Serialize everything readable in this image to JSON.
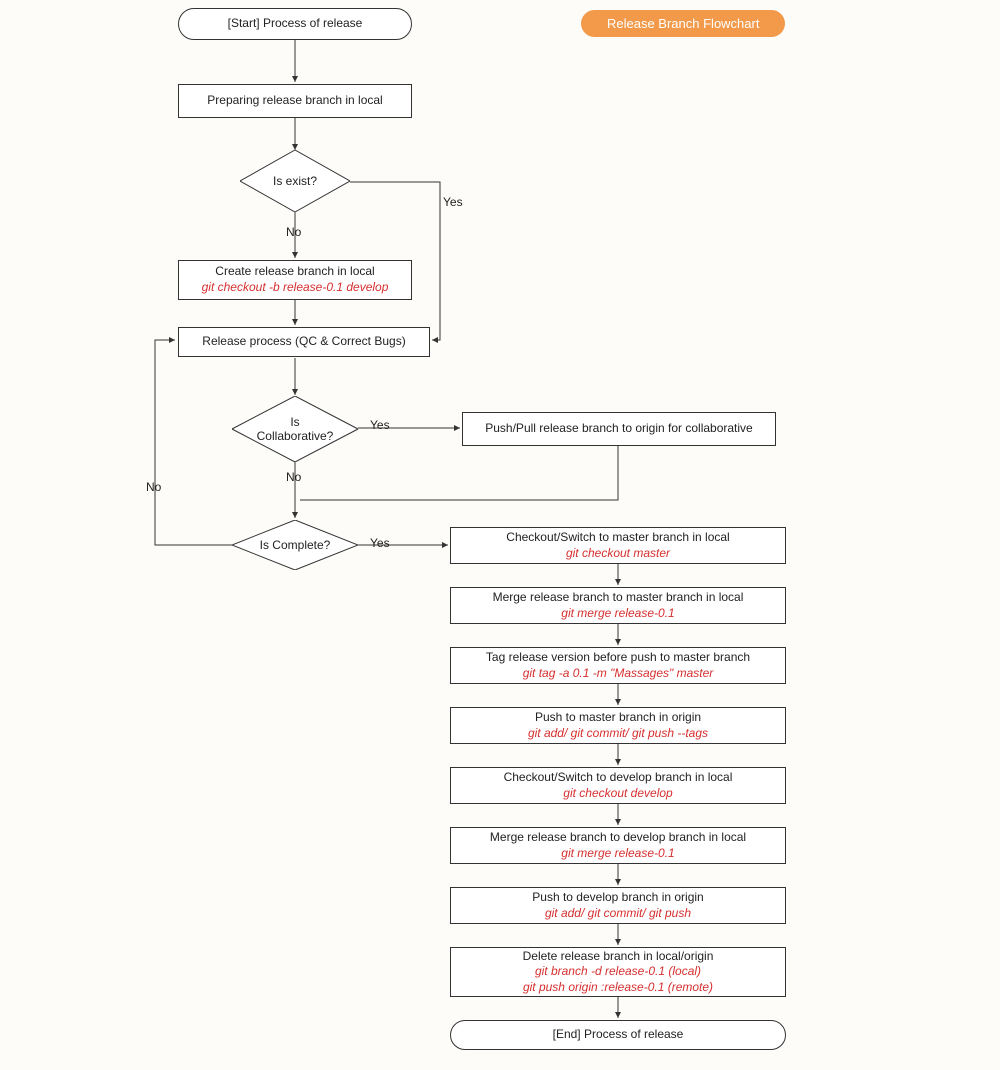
{
  "title_badge": "Release Branch Flowchart",
  "nodes": {
    "start": "[Start] Process of release",
    "prepare": "Preparing release branch in local",
    "exist_q": "Is exist?",
    "create": {
      "text": "Create release branch in local",
      "cmd": "git checkout -b release-0.1 develop"
    },
    "qc": "Release process (QC & Correct Bugs)",
    "collab_q": "Is\nCollaborative?",
    "pushpull": "Push/Pull release branch to origin for collaborative",
    "complete_q": "Is Complete?",
    "checkout_master": {
      "text": "Checkout/Switch to master branch in local",
      "cmd": "git checkout master"
    },
    "merge_master": {
      "text": "Merge release branch to master branch in local",
      "cmd": "git merge release-0.1"
    },
    "tag": {
      "text": "Tag release version before push to master branch",
      "cmd": "git tag -a 0.1 -m \"Massages\" master"
    },
    "push_master": {
      "text": "Push to master branch in origin",
      "cmd": "git add/ git commit/ git push --tags"
    },
    "checkout_develop": {
      "text": "Checkout/Switch to develop branch in local",
      "cmd": "git checkout develop"
    },
    "merge_develop": {
      "text": "Merge release branch to develop branch in local",
      "cmd": "git merge release-0.1"
    },
    "push_develop": {
      "text": "Push to develop branch in origin",
      "cmd": "git add/ git commit/ git push"
    },
    "delete": {
      "text": "Delete release branch in local/origin",
      "cmd1": "git branch -d release-0.1 (local)",
      "cmd2": "git push origin :release-0.1 (remote)"
    },
    "end": "[End] Process of release"
  },
  "labels": {
    "yes": "Yes",
    "no": "No"
  }
}
